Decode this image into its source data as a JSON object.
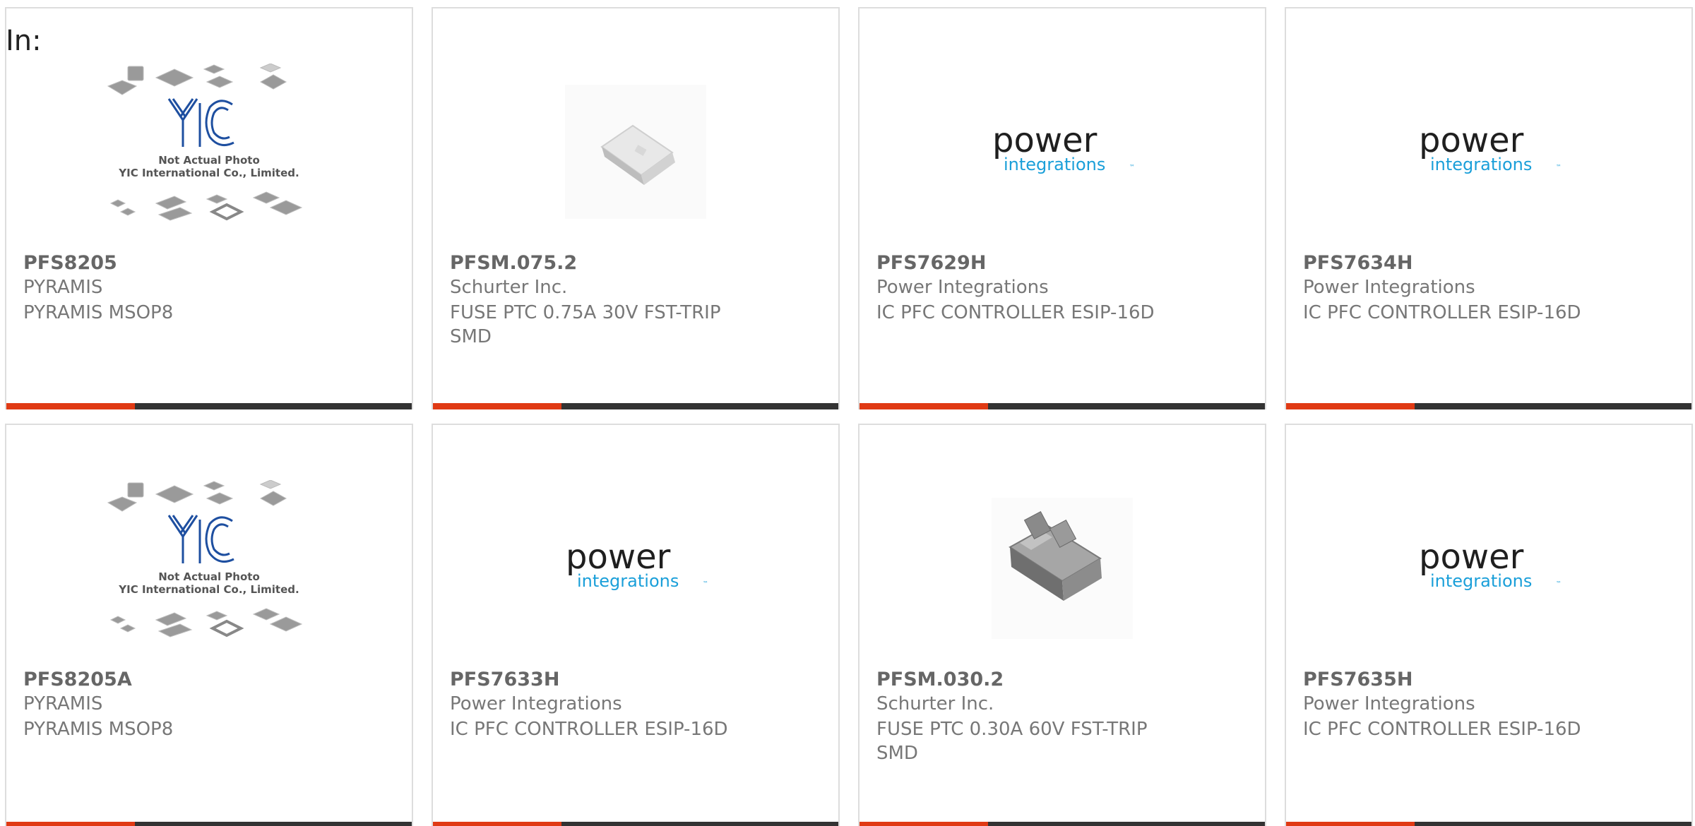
{
  "header": {
    "in_label": "In:"
  },
  "colors": {
    "accent": "#e03a14",
    "bar": "#333333",
    "border": "#dddddd",
    "text": "#666666",
    "brand_blue": "#1a9fd9"
  },
  "products": [
    {
      "part": "PFS8205",
      "manufacturer": "PYRAMIS",
      "description": "PYRAMIS MSOP8",
      "image": "yic-placeholder",
      "image_text": {
        "line1": "Not Actual Photo",
        "line2": "YIC International Co., Limited.",
        "logo": "YIC"
      }
    },
    {
      "part": "PFSM.075.2",
      "manufacturer": "Schurter Inc.",
      "description": "FUSE PTC 0.75A 30V FST-TRIP SMD",
      "image": "fuse-photo"
    },
    {
      "part": "PFS7629H",
      "manufacturer": "Power Integrations",
      "description": "IC PFC CONTROLLER ESIP-16D",
      "image": "power-integrations-logo",
      "image_text": {
        "word1": "power",
        "word2": "integrations",
        "tm": "™"
      }
    },
    {
      "part": "PFS7634H",
      "manufacturer": "Power Integrations",
      "description": "IC PFC CONTROLLER ESIP-16D",
      "image": "power-integrations-logo",
      "image_text": {
        "word1": "power",
        "word2": "integrations",
        "tm": "™"
      }
    },
    {
      "part": "PFS8205A",
      "manufacturer": "PYRAMIS",
      "description": "PYRAMIS MSOP8",
      "image": "yic-placeholder",
      "image_text": {
        "line1": "Not Actual Photo",
        "line2": "YIC International Co., Limited.",
        "logo": "YIC"
      }
    },
    {
      "part": "PFS7633H",
      "manufacturer": "Power Integrations",
      "description": "IC PFC CONTROLLER ESIP-16D",
      "image": "power-integrations-logo",
      "image_text": {
        "word1": "power",
        "word2": "integrations",
        "tm": "™"
      }
    },
    {
      "part": "PFSM.030.2",
      "manufacturer": "Schurter Inc.",
      "description": "FUSE PTC 0.30A 60V FST-TRIP SMD",
      "image": "fuse-photo-clear"
    },
    {
      "part": "PFS7635H",
      "manufacturer": "Power Integrations",
      "description": "IC PFC CONTROLLER ESIP-16D",
      "image": "power-integrations-logo",
      "image_text": {
        "word1": "power",
        "word2": "integrations",
        "tm": "™"
      }
    }
  ]
}
